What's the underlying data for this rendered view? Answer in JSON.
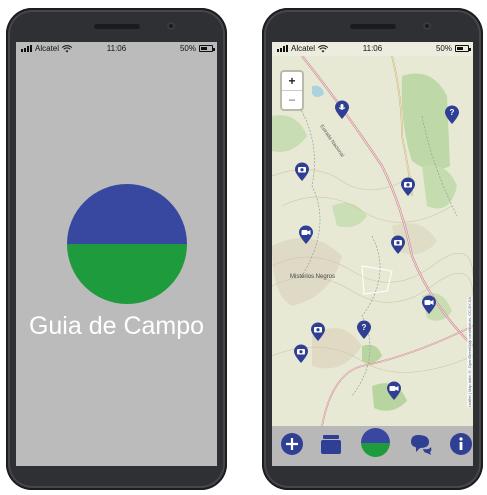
{
  "status": {
    "carrier": "Alcatel",
    "time": "11:06",
    "battery": "50%",
    "battery_level": 0.5
  },
  "splash": {
    "title": "Guia de Campo",
    "colors": {
      "top": "#3848a0",
      "bottom": "#1e9b3c",
      "background": "#bbbbbb"
    }
  },
  "map": {
    "zoom_in": "+",
    "zoom_out": "−",
    "place_label": "Mistérios Negros",
    "road_label": "Estrada Nacional",
    "attribution": "Leaflet | Map data © OpenStreetMap contributors, CC-BY-SA",
    "pin_color": "#2f3f94",
    "pins": [
      "microphone-icon",
      "question-icon",
      "camera-icon",
      "camera-icon",
      "video-icon",
      "camera-icon",
      "video-icon",
      "question-icon",
      "camera-icon",
      "camera-icon",
      "video-icon"
    ]
  },
  "toolbar": {
    "items": [
      {
        "name": "add-button",
        "icon": "plus-icon"
      },
      {
        "name": "layers-button",
        "icon": "cards-icon"
      },
      {
        "name": "home-button",
        "icon": "logo-icon"
      },
      {
        "name": "chat-button",
        "icon": "chat-bubbles-icon"
      },
      {
        "name": "info-button",
        "icon": "info-icon"
      }
    ],
    "color": "#2f3f94"
  }
}
